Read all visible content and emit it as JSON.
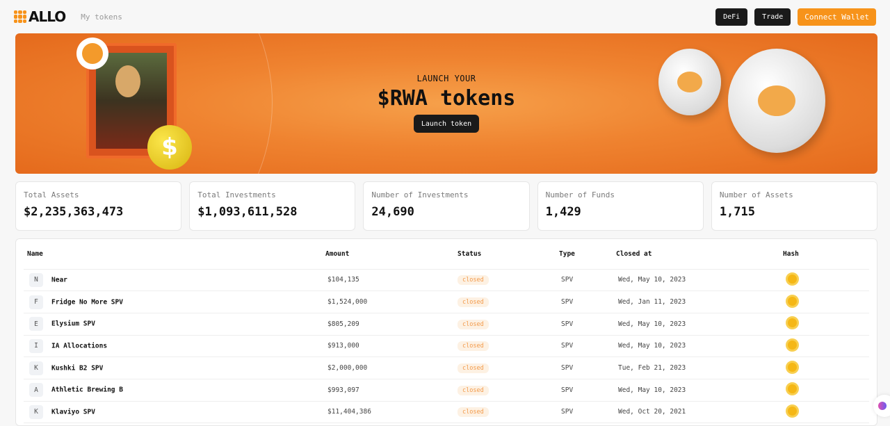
{
  "header": {
    "logo": "ALLO",
    "nav_my_tokens": "My tokens",
    "defi": "DeFi",
    "trade": "Trade",
    "connect": "Connect Wallet"
  },
  "hero": {
    "subtitle": "LAUNCH YOUR",
    "title": "$RWA tokens",
    "button": "Launch token",
    "coin_symbol": "$"
  },
  "stats": [
    {
      "label": "Total Assets",
      "value": "$2,235,363,473"
    },
    {
      "label": "Total Investments",
      "value": "$1,093,611,528"
    },
    {
      "label": "Number of Investments",
      "value": "24,690"
    },
    {
      "label": "Number of Funds",
      "value": "1,429"
    },
    {
      "label": "Number of Assets",
      "value": "1,715"
    }
  ],
  "table": {
    "headers": {
      "name": "Name",
      "amount": "Amount",
      "status": "Status",
      "type": "Type",
      "closed": "Closed at",
      "hash": "Hash"
    },
    "rows": [
      {
        "initial": "N",
        "name": "Near",
        "amount": "$104,135",
        "status": "closed",
        "type": "SPV",
        "closed": "Wed, May 10, 2023"
      },
      {
        "initial": "F",
        "name": "Fridge No More SPV",
        "amount": "$1,524,000",
        "status": "closed",
        "type": "SPV",
        "closed": "Wed, Jan 11, 2023"
      },
      {
        "initial": "E",
        "name": "Elysium SPV",
        "amount": "$805,209",
        "status": "closed",
        "type": "SPV",
        "closed": "Wed, May 10, 2023"
      },
      {
        "initial": "I",
        "name": "IA Allocations",
        "amount": "$913,000",
        "status": "closed",
        "type": "SPV",
        "closed": "Wed, May 10, 2023"
      },
      {
        "initial": "K",
        "name": "Kushki B2 SPV",
        "amount": "$2,000,000",
        "status": "closed",
        "type": "SPV",
        "closed": "Tue, Feb 21, 2023"
      },
      {
        "initial": "A",
        "name": "Athletic Brewing B",
        "amount": "$993,097",
        "status": "closed",
        "type": "SPV",
        "closed": "Wed, May 10, 2023"
      },
      {
        "initial": "K",
        "name": "Klaviyo SPV",
        "amount": "$11,404,386",
        "status": "closed",
        "type": "SPV",
        "closed": "Wed, Oct 20, 2021"
      }
    ]
  },
  "colors": {
    "accent": "#f7931a",
    "badge_text": "#f39a4a",
    "hash": "#f5b716"
  }
}
